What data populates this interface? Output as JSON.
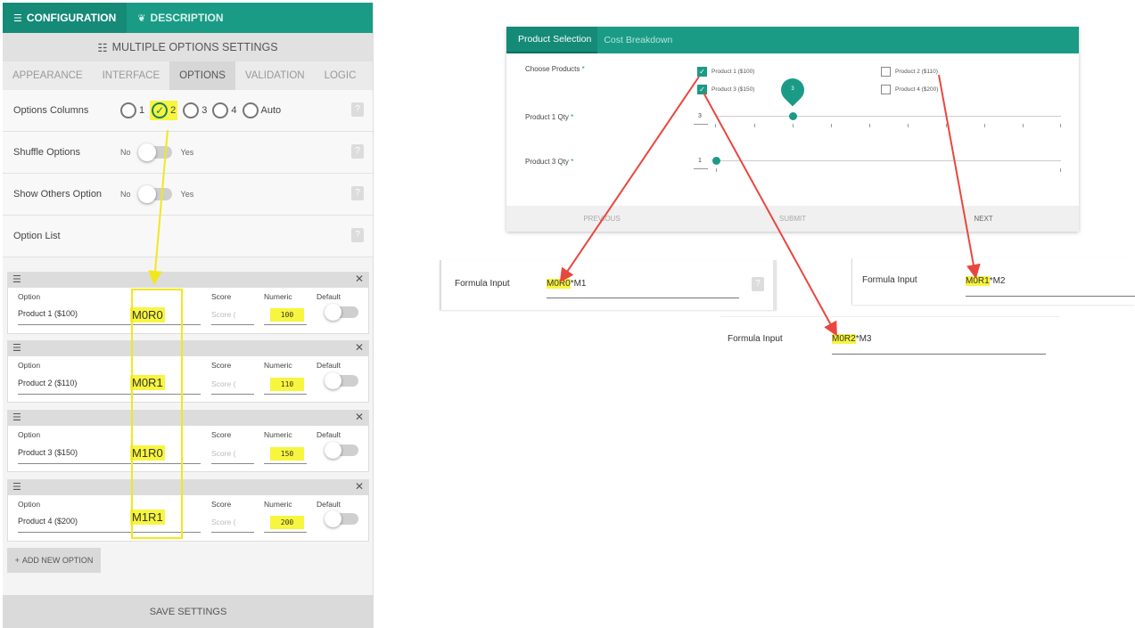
{
  "top_tabs": [
    {
      "label": "CONFIGURATION",
      "icon": "menu-icon"
    },
    {
      "label": "DESCRIPTION",
      "icon": "leaf-icon"
    }
  ],
  "panel_header": {
    "title": "MULTIPLE OPTIONS SETTINGS",
    "icon": "sliders-icon"
  },
  "sub_tabs": [
    "APPEARANCE",
    "INTERFACE",
    "OPTIONS",
    "VALIDATION",
    "LOGIC"
  ],
  "active_sub_tab": "OPTIONS",
  "settings": {
    "options_columns": {
      "label": "Options Columns",
      "choices": [
        "1",
        "2",
        "3",
        "4",
        "Auto"
      ],
      "selected": "2"
    },
    "shuffle_options": {
      "label": "Shuffle Options",
      "off": "No",
      "on": "Yes"
    },
    "show_others": {
      "label": "Show Others Option",
      "off": "No",
      "on": "Yes"
    },
    "option_list": {
      "label": "Option List"
    }
  },
  "field_labels": {
    "option": "Option",
    "score": "Score",
    "numeric": "Numeric",
    "default": "Default",
    "score_placeholder": "Score ("
  },
  "options": [
    {
      "name": "Product 1 ($100)",
      "numeric": "100",
      "code": "M0R0"
    },
    {
      "name": "Product 2 ($110)",
      "numeric": "110",
      "code": "M0R1"
    },
    {
      "name": "Product 3 ($150)",
      "numeric": "150",
      "code": "M1R0"
    },
    {
      "name": "Product 4 ($200)",
      "numeric": "200",
      "code": "M1R1"
    }
  ],
  "add_option_label": "ADD NEW OPTION",
  "save_label": "SAVE SETTINGS",
  "preview": {
    "tabs": [
      "Product Selection",
      "Cost Breakdown"
    ],
    "choose_label": "Choose Products",
    "products": [
      {
        "label": "Product 1 ($100)",
        "checked": true
      },
      {
        "label": "Product 2 ($110)",
        "checked": false
      },
      {
        "label": "Product 3 ($150)",
        "checked": true
      },
      {
        "label": "Product 4 ($200)",
        "checked": false
      }
    ],
    "qty1": {
      "label": "Product 1 Qty",
      "value": "3",
      "pin": "3"
    },
    "qty3": {
      "label": "Product 3 Qty",
      "value": "1"
    },
    "buttons": {
      "previous": "PREVIOUS",
      "submit": "SUBMIT",
      "next": "NEXT"
    },
    "required_mark": "*"
  },
  "formulas": [
    {
      "label": "Formula Input",
      "code": "M0R0",
      "rest": "*M1"
    },
    {
      "label": "Formula Input",
      "code": "M0R1",
      "rest": "*M2"
    },
    {
      "label": "Formula Input",
      "code": "M0R2",
      "rest": "*M3"
    }
  ],
  "colors": {
    "accent": "#1a9b86",
    "highlight": "#f7f53d",
    "arrow": "#e8473f",
    "frame": "#f2e71e"
  }
}
